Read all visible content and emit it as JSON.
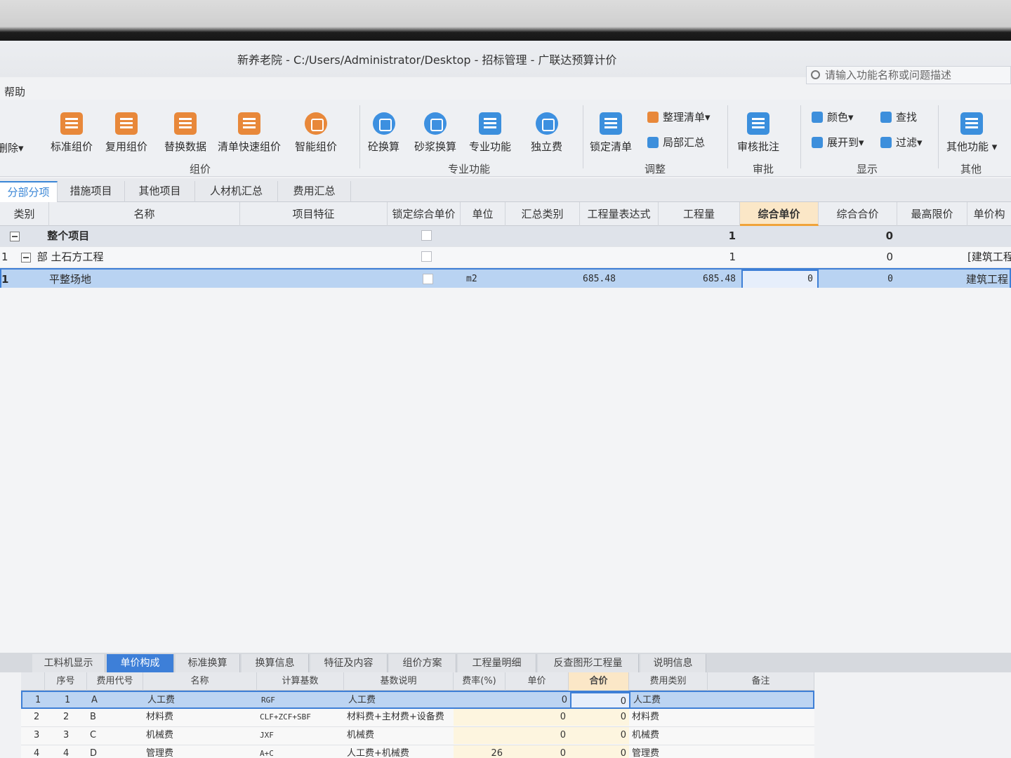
{
  "window": {
    "title": "新养老院 - C:/Users/Administrator/Desktop - 招标管理 - 广联达预算计价",
    "search_placeholder": "请输入功能名称或问题描述",
    "menu_help": "帮助"
  },
  "ribbon": {
    "delete_label": "删除",
    "buttons": {
      "standard_group": "标准组价",
      "reuse_group": "复用组价",
      "replace_data": "替换数据",
      "quick_list_group": "清单快速组价",
      "smart_group": "智能组价",
      "concrete_convert": "砼换算",
      "mortar_convert": "砂浆换算",
      "special_function": "专业功能",
      "independent_fee": "独立费",
      "lock_list": "锁定清单",
      "organize_list": "整理清单",
      "partial_summary": "局部汇总",
      "review_annotation": "审核批注",
      "color": "颜色",
      "find": "查找",
      "expand_to": "展开到",
      "filter": "过滤",
      "other_functions": "其他功能"
    },
    "groups": {
      "group_price": "组价",
      "special": "专业功能",
      "adjust": "调整",
      "review": "审批",
      "display": "显示",
      "other": "其他"
    }
  },
  "tabs": [
    "分部分项",
    "措施项目",
    "其他项目",
    "人材机汇总",
    "费用汇总"
  ],
  "grid": {
    "headers": {
      "category": "类别",
      "name": "名称",
      "feature": "项目特征",
      "lock_price": "锁定综合单价",
      "unit": "单位",
      "summary_type": "汇总类别",
      "qty_expr": "工程量表达式",
      "qty": "工程量",
      "unit_price": "综合单价",
      "total_price": "综合合价",
      "max_price": "最高限价",
      "price_comp": "单价构"
    },
    "rows": [
      {
        "seq": "",
        "name": "整个项目",
        "unit": "",
        "qty_expr": "",
        "qty": "1",
        "unit_price": "",
        "total": "0",
        "price_comp": ""
      },
      {
        "seq": "1",
        "name": "部 土石方工程",
        "unit": "",
        "qty_expr": "",
        "qty": "1",
        "unit_price": "",
        "total": "0",
        "price_comp": "[建筑工程"
      },
      {
        "seq": "1",
        "name": "平整场地",
        "unit": "m2",
        "qty_expr": "685.48",
        "qty": "685.48",
        "unit_price": "0",
        "total": "0",
        "price_comp": "建筑工程"
      }
    ]
  },
  "bottom_tabs": [
    "工料机显示",
    "单价构成",
    "标准换算",
    "换算信息",
    "特征及内容",
    "组价方案",
    "工程量明细",
    "反查图形工程量",
    "说明信息"
  ],
  "bottom_grid": {
    "headers": {
      "seq": "序号",
      "code": "费用代号",
      "name": "名称",
      "base": "计算基数",
      "base_desc": "基数说明",
      "rate": "费率(%)",
      "unit_price": "单价",
      "total": "合价",
      "fee_type": "费用类别",
      "remark": "备注"
    },
    "rows": [
      {
        "row": "1",
        "seq": "1",
        "code": "A",
        "name": "人工费",
        "base": "RGF",
        "desc": "人工费",
        "rate": "",
        "price": "0",
        "total": "0",
        "type": "人工费"
      },
      {
        "row": "2",
        "seq": "2",
        "code": "B",
        "name": "材料费",
        "base": "CLF+ZCF+SBF",
        "desc": "材料费+主材费+设备费",
        "rate": "",
        "price": "0",
        "total": "0",
        "type": "材料费"
      },
      {
        "row": "3",
        "seq": "3",
        "code": "C",
        "name": "机械费",
        "base": "JXF",
        "desc": "机械费",
        "rate": "",
        "price": "0",
        "total": "0",
        "type": "机械费"
      },
      {
        "row": "4",
        "seq": "4",
        "code": "D",
        "name": "管理费",
        "base": "A+C",
        "desc": "人工费+机械费",
        "rate": "26",
        "price": "0",
        "total": "0",
        "type": "管理费"
      }
    ]
  }
}
